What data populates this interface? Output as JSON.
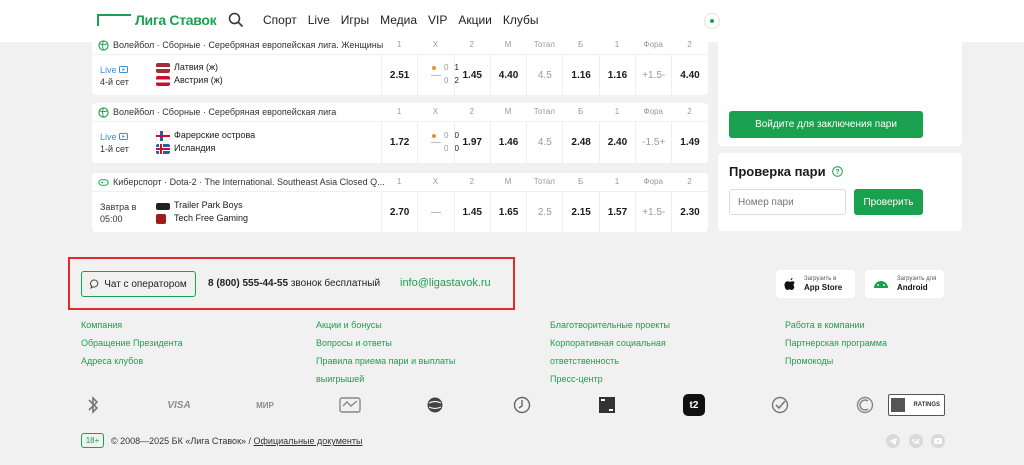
{
  "header": {
    "logo_text": "Лига Ставок",
    "nav": [
      "Спорт",
      "Live",
      "Игры",
      "Медиа",
      "VIP",
      "Акции",
      "Клубы"
    ]
  },
  "events": [
    {
      "title": "Волейбол · Сборные · Серебряная европейская лига. Женщины",
      "markets": [
        "1",
        "X",
        "2",
        "М",
        "Тотал",
        "Б",
        "1",
        "Фора",
        "2"
      ],
      "status_live": "Live",
      "status_period": "4-й сет",
      "team1": "Латвия (ж)",
      "team2": "Австрия (ж)",
      "score1": [
        "0",
        "1"
      ],
      "score2": [
        "0",
        "2"
      ],
      "odds": [
        "2.51",
        "—",
        "1.45",
        "4.40",
        "4.5",
        "1.16",
        "1.16",
        "+1.5-",
        "4.40"
      ]
    },
    {
      "title": "Волейбол · Сборные · Серебряная европейская лига",
      "markets": [
        "1",
        "X",
        "2",
        "М",
        "Тотал",
        "Б",
        "1",
        "Фора",
        "2"
      ],
      "status_live": "Live",
      "status_period": "1-й сет",
      "team1": "Фарерские острова",
      "team2": "Исландия",
      "score1": [
        "0",
        "0"
      ],
      "score2": [
        "0",
        "0"
      ],
      "odds": [
        "1.72",
        "—",
        "1.97",
        "1.46",
        "4.5",
        "2.48",
        "2.40",
        "-1.5+",
        "1.49"
      ]
    },
    {
      "title": "Киберспорт · Dota-2 · The International. Southeast Asia Closed Q...",
      "markets": [
        "1",
        "X",
        "2",
        "М",
        "Тотал",
        "Б",
        "1",
        "Фора",
        "2"
      ],
      "status_live": "Завтра в",
      "status_period": "05:00",
      "team1": "Trailer Park Boys",
      "team2": "Tech Free Gaming",
      "odds": [
        "2.70",
        "—",
        "1.45",
        "1.65",
        "2.5",
        "2.15",
        "1.57",
        "+1.5-",
        "2.30"
      ]
    }
  ],
  "sidebar": {
    "login_button": "Войдите для заключения пари",
    "check_title": "Проверка пари",
    "check_placeholder": "Номер пари",
    "check_button": "Проверить"
  },
  "contact": {
    "chat_button": "Чат с оператором",
    "phone": "8 (800) 555-44-55",
    "phone_note": "звонок бесплатный",
    "email": "info@ligastavok.ru"
  },
  "apps": {
    "appstore_small": "Загрузить в",
    "appstore_name": "App Store",
    "android_small": "Загрузить для",
    "android_name": "Android"
  },
  "footer_links": [
    [
      "Компания",
      "Обращение Президента",
      "Адреса клубов"
    ],
    [
      "Акции и бонусы",
      "Вопросы и ответы",
      "Правила приема пари и выплаты",
      "выигрышей"
    ],
    [
      "Благотворительные проекты",
      "Корпоративная социальная",
      "ответственность",
      "Пресс-центр"
    ],
    [
      "Работа в компании",
      "Партнерская программа",
      "Промокоды"
    ]
  ],
  "payments": {
    "visa": "VISA",
    "mir": "МИР",
    "t2": "t2",
    "rating": "RATINGS"
  },
  "bottom": {
    "age": "18+",
    "copyright": "© 2008—2025 БК «Лига Ставок» /",
    "docs_link": "Официальные документы"
  }
}
